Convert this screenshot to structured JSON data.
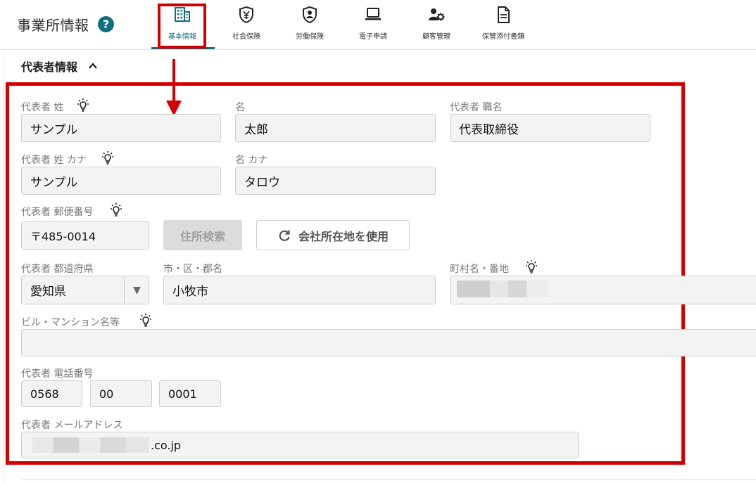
{
  "header": {
    "title": "事業所情報",
    "help": "?",
    "tabs": [
      {
        "label": "基本情報",
        "icon": "building-icon",
        "active": true
      },
      {
        "label": "社会保険",
        "icon": "yen-shield-icon"
      },
      {
        "label": "労働保険",
        "icon": "person-shield-icon"
      },
      {
        "label": "電子申請",
        "icon": "laptop-icon"
      },
      {
        "label": "顧客管理",
        "icon": "user-gear-icon"
      },
      {
        "label": "保管添付書類",
        "icon": "document-icon"
      }
    ]
  },
  "section": {
    "title": "代表者情報",
    "chevron": "^"
  },
  "fields": {
    "last_name": {
      "label": "代表者 姓",
      "value": "サンプル"
    },
    "first_name": {
      "label": "名",
      "value": "太郎"
    },
    "job_title": {
      "label": "代表者 職名",
      "value": "代表取締役"
    },
    "last_name_kana": {
      "label": "代表者 姓 カナ",
      "value": "サンプル"
    },
    "first_name_kana": {
      "label": "名 カナ",
      "value": "タロウ"
    },
    "postal_code": {
      "label": "代表者 郵便番号",
      "value": "〒485-0014"
    },
    "address_search_button": "住所検索",
    "use_company_address_button": "会社所在地を使用",
    "prefecture": {
      "label": "代表者 都道府県",
      "value": "愛知県"
    },
    "city": {
      "label": "市・区・郡名",
      "value": "小牧市"
    },
    "town": {
      "label": "町村名・番地",
      "value": ""
    },
    "building": {
      "label": "ビル・マンション名等",
      "value": ""
    },
    "phone": {
      "label": "代表者 電話番号",
      "part1": "0568",
      "part2": "00",
      "part3": "0001"
    },
    "email": {
      "label": "代表者 メールアドレス",
      "value_suffix": ".co.jp"
    }
  },
  "colors": {
    "accent": "#0f6e80",
    "highlight_red": "#d40000",
    "field_bg": "#f4f3f4"
  }
}
